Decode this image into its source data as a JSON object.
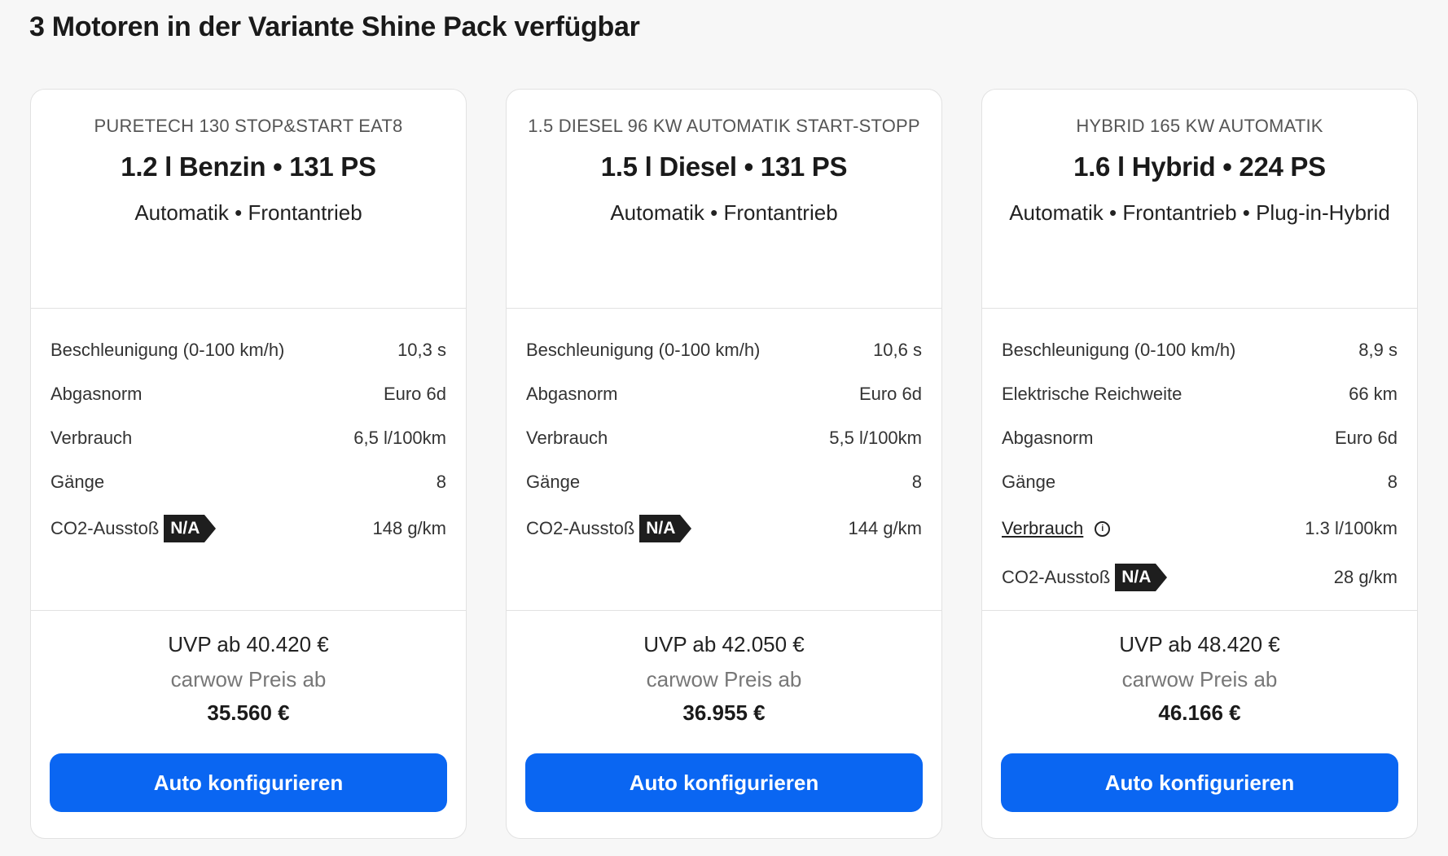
{
  "heading": "3 Motoren in der Variante Shine Pack verfügbar",
  "na_badge": "N/A",
  "info_icon": "info-circle-icon",
  "accent_color": "#0a66f2",
  "cards": [
    {
      "engine_code": "PURETECH 130 STOP&START EAT8",
      "headline": "1.2 l Benzin • 131 PS",
      "subline": "Automatik • Frontantrieb",
      "specs": [
        {
          "label": "Beschleunigung (0-100 km/h)",
          "value": "10,3 s"
        },
        {
          "label": "Abgasnorm",
          "value": "Euro 6d"
        },
        {
          "label": "Verbrauch",
          "value": "6,5 l/100km"
        },
        {
          "label": "Gänge",
          "value": "8"
        },
        {
          "label": "CO2-Ausstoß",
          "value": "148 g/km"
        }
      ],
      "uvp": "UVP ab 40.420 €",
      "carwow_label": "carwow Preis ab",
      "carwow_price": "35.560 €",
      "button": "Auto konfigurieren"
    },
    {
      "engine_code": "1.5 DIESEL 96 KW AUTOMATIK START-STOPP",
      "headline": "1.5 l Diesel • 131 PS",
      "subline": "Automatik • Frontantrieb",
      "specs": [
        {
          "label": "Beschleunigung (0-100 km/h)",
          "value": "10,6 s"
        },
        {
          "label": "Abgasnorm",
          "value": "Euro 6d"
        },
        {
          "label": "Verbrauch",
          "value": "5,5 l/100km"
        },
        {
          "label": "Gänge",
          "value": "8"
        },
        {
          "label": "CO2-Ausstoß",
          "value": "144 g/km"
        }
      ],
      "uvp": "UVP ab 42.050 €",
      "carwow_label": "carwow Preis ab",
      "carwow_price": "36.955 €",
      "button": "Auto konfigurieren"
    },
    {
      "engine_code": "HYBRID 165 KW AUTOMATIK",
      "headline": "1.6 l Hybrid • 224 PS",
      "subline": "Automatik • Frontantrieb • Plug-in-Hybrid",
      "specs": [
        {
          "label": "Beschleunigung (0-100 km/h)",
          "value": "8,9 s"
        },
        {
          "label": "Elektrische Reichweite",
          "value": "66 km"
        },
        {
          "label": "Abgasnorm",
          "value": "Euro 6d"
        },
        {
          "label": "Gänge",
          "value": "8"
        },
        {
          "label": "Verbrauch",
          "value": "1.3 l/100km"
        },
        {
          "label": "CO2-Ausstoß",
          "value": "28 g/km"
        }
      ],
      "uvp": "UVP ab 48.420 €",
      "carwow_label": "carwow Preis ab",
      "carwow_price": "46.166 €",
      "button": "Auto konfigurieren"
    }
  ]
}
